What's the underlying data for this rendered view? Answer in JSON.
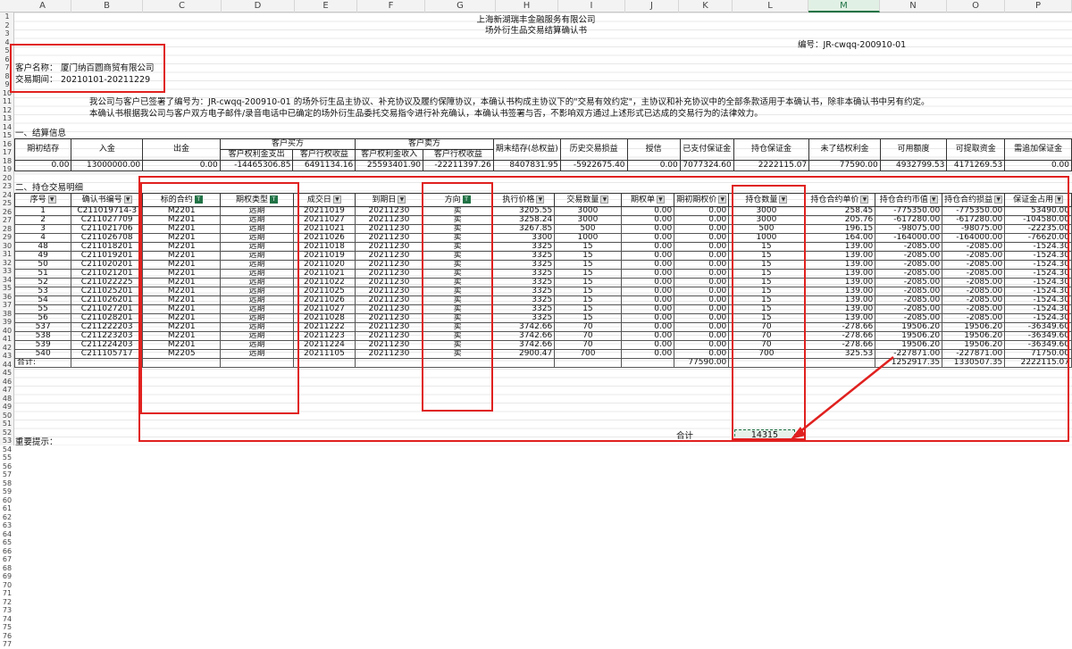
{
  "sheet": {
    "columns": [
      "A",
      "B",
      "C",
      "D",
      "E",
      "F",
      "G",
      "H",
      "I",
      "J",
      "K",
      "L",
      "M",
      "N",
      "O",
      "P"
    ],
    "selected_column": "M",
    "row_numbers": [
      "1",
      "2",
      "3",
      "4",
      "5",
      "6",
      "7",
      "8",
      "9",
      "10",
      "11",
      "12",
      "13",
      "14",
      "15",
      "16",
      "17",
      "18",
      "19",
      "20",
      "23",
      "24",
      "25",
      "26",
      "27",
      "28",
      "29",
      "30",
      "31",
      "32",
      "33",
      "34",
      "35",
      "36",
      "37",
      "38",
      "39",
      "40",
      "41",
      "42",
      "43",
      "44",
      "45",
      "46",
      "47",
      "48",
      "49",
      "50",
      "51",
      "52",
      "53",
      "54",
      "55",
      "56",
      "57",
      "58",
      "59",
      "60",
      "61",
      "62",
      "63",
      "64",
      "65",
      "66",
      "67",
      "68",
      "69",
      "70",
      "71",
      "72",
      "73",
      "74",
      "75",
      "76",
      "77"
    ]
  },
  "header": {
    "company": "上海新湖瑞丰金融服务有限公司",
    "doc_title": "场外衍生品交易结算确认书",
    "doc_no": "编号：JR-cwqq-200910-01",
    "client_label": "客户名称：",
    "client_name": "厦门纳百圆商贸有限公司",
    "period_label": "交易期间：",
    "period": "20210101-20211229",
    "para1": "我公司与客户已签署了编号为：JR-cwqq-200910-01 的场外衍生品主协议、补充协议及履约保障协议，本确认书构成主协议下的\"交易有效约定\"，主协议和补充协议中的全部条款适用于本确认书，除非本确认书中另有约定。",
    "para2": "本确认书根据我公司与客户双方电子邮件/录音电话中已确定的场外衍生品委托交易指令进行补充确认，本确认书签署与否，不影响双方通过上述形式已达成的交易行为的法律效力。"
  },
  "summary": {
    "section_title": "一、结算信息",
    "headers_top": {
      "buyer": "客户买方",
      "seller": "客户卖方"
    },
    "headers": [
      "期初结存",
      "入金",
      "出金",
      "客户权利金支出",
      "客户行权收益",
      "客户权利金收入",
      "客户行权收益",
      "期末结存(总权益)",
      "历史交易损益",
      "授信",
      "已支付保证金",
      "持仓保证金",
      "未了结权利金",
      "可用额度",
      "可提取资金",
      "需追加保证金"
    ],
    "values": [
      "0.00",
      "13000000.00",
      "0.00",
      "-14465306.85",
      "6491134.16",
      "25593401.90",
      "-22211397.26",
      "8407831.95",
      "-5922675.40",
      "0.00",
      "7077324.60",
      "2222115.07",
      "77590.00",
      "4932799.53",
      "4171269.53",
      "0.00"
    ]
  },
  "detail": {
    "section_title": "二、持仓交易明细",
    "headers": [
      "序号",
      "确认书编号",
      "标的合约",
      "期权类型",
      "成交日",
      "到期日",
      "方向",
      "执行价格",
      "交易数量",
      "期权单",
      "期初期权价",
      "持仓数量",
      "持仓合约单价",
      "持仓合约市值",
      "持仓合约损益",
      "保证金占用"
    ],
    "rows": [
      [
        "1",
        "C211019714-3",
        "M2201",
        "远期",
        "20211019",
        "20211230",
        "卖",
        "3205.55",
        "3000",
        "0.00",
        "0.00",
        "3000",
        "258.45",
        "-775350.00",
        "-775350.00",
        "53490.00"
      ],
      [
        "2",
        "C211027709",
        "M2201",
        "远期",
        "20211027",
        "20211230",
        "卖",
        "3258.24",
        "3000",
        "0.00",
        "0.00",
        "3000",
        "205.76",
        "-617280.00",
        "-617280.00",
        "-104580.00"
      ],
      [
        "3",
        "C211021706",
        "M2201",
        "远期",
        "20211021",
        "20211230",
        "卖",
        "3267.85",
        "500",
        "0.00",
        "0.00",
        "500",
        "196.15",
        "-98075.00",
        "-98075.00",
        "-22235.00"
      ],
      [
        "4",
        "C211026708",
        "M2201",
        "远期",
        "20211026",
        "20211230",
        "卖",
        "3300",
        "1000",
        "0.00",
        "0.00",
        "1000",
        "164.00",
        "-164000.00",
        "-164000.00",
        "-76620.00"
      ],
      [
        "48",
        "C211018201",
        "M2201",
        "远期",
        "20211018",
        "20211230",
        "卖",
        "3325",
        "15",
        "0.00",
        "0.00",
        "15",
        "139.00",
        "-2085.00",
        "-2085.00",
        "-1524.30"
      ],
      [
        "49",
        "C211019201",
        "M2201",
        "远期",
        "20211019",
        "20211230",
        "卖",
        "3325",
        "15",
        "0.00",
        "0.00",
        "15",
        "139.00",
        "-2085.00",
        "-2085.00",
        "-1524.30"
      ],
      [
        "50",
        "C211020201",
        "M2201",
        "远期",
        "20211020",
        "20211230",
        "卖",
        "3325",
        "15",
        "0.00",
        "0.00",
        "15",
        "139.00",
        "-2085.00",
        "-2085.00",
        "-1524.30"
      ],
      [
        "51",
        "C211021201",
        "M2201",
        "远期",
        "20211021",
        "20211230",
        "卖",
        "3325",
        "15",
        "0.00",
        "0.00",
        "15",
        "139.00",
        "-2085.00",
        "-2085.00",
        "-1524.30"
      ],
      [
        "52",
        "C211022225",
        "M2201",
        "远期",
        "20211022",
        "20211230",
        "卖",
        "3325",
        "15",
        "0.00",
        "0.00",
        "15",
        "139.00",
        "-2085.00",
        "-2085.00",
        "-1524.30"
      ],
      [
        "53",
        "C211025201",
        "M2201",
        "远期",
        "20211025",
        "20211230",
        "卖",
        "3325",
        "15",
        "0.00",
        "0.00",
        "15",
        "139.00",
        "-2085.00",
        "-2085.00",
        "-1524.30"
      ],
      [
        "54",
        "C211026201",
        "M2201",
        "远期",
        "20211026",
        "20211230",
        "卖",
        "3325",
        "15",
        "0.00",
        "0.00",
        "15",
        "139.00",
        "-2085.00",
        "-2085.00",
        "-1524.30"
      ],
      [
        "55",
        "C211027201",
        "M2201",
        "远期",
        "20211027",
        "20211230",
        "卖",
        "3325",
        "15",
        "0.00",
        "0.00",
        "15",
        "139.00",
        "-2085.00",
        "-2085.00",
        "-1524.30"
      ],
      [
        "56",
        "C211028201",
        "M2201",
        "远期",
        "20211028",
        "20211230",
        "卖",
        "3325",
        "15",
        "0.00",
        "0.00",
        "15",
        "139.00",
        "-2085.00",
        "-2085.00",
        "-1524.30"
      ],
      [
        "537",
        "C211222203",
        "M2201",
        "远期",
        "20211222",
        "20211230",
        "卖",
        "3742.66",
        "70",
        "0.00",
        "0.00",
        "70",
        "-278.66",
        "19506.20",
        "19506.20",
        "-36349.60"
      ],
      [
        "538",
        "C211223203",
        "M2201",
        "远期",
        "20211223",
        "20211230",
        "卖",
        "3742.66",
        "70",
        "0.00",
        "0.00",
        "70",
        "-278.66",
        "19506.20",
        "19506.20",
        "-36349.60"
      ],
      [
        "539",
        "C211224203",
        "M2201",
        "远期",
        "20211224",
        "20211230",
        "卖",
        "3742.66",
        "70",
        "0.00",
        "0.00",
        "70",
        "-278.66",
        "19506.20",
        "19506.20",
        "-36349.60"
      ],
      [
        "540",
        "C211105717",
        "M2205",
        "远期",
        "20211105",
        "20211230",
        "卖",
        "2900.47",
        "700",
        "0.00",
        "0.00",
        "700",
        "325.53",
        "-227871.00",
        "-227871.00",
        "71750.00"
      ]
    ],
    "total_label": "合计:",
    "total_k": "77590.00",
    "total_n": "1252917.35",
    "total_o": "1330507.35",
    "total_p": "2222115.07",
    "sum_label": "合计",
    "sum_value": "14315",
    "footer_note": "重要提示："
  },
  "colors": {
    "annotation": "#e0211f",
    "excel_green": "#217346"
  }
}
